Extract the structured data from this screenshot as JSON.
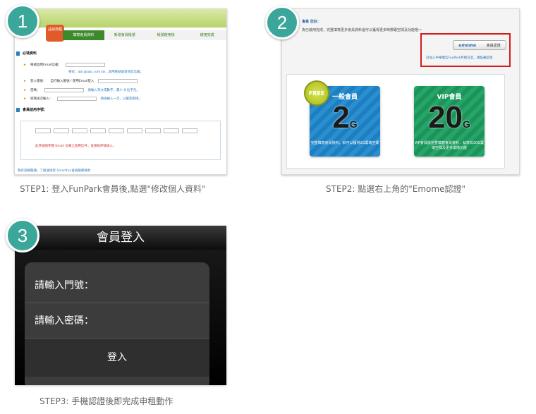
{
  "steps": [
    {
      "number": "1",
      "caption": "STEP1: 登入FunPark會員後,點選\"修改個人資料\"",
      "screenshot": {
        "mascot_text": "註冊流程",
        "nav_items": [
          "填寫會員資料",
          "新增會員帳號",
          "帳號啟用後",
          "啟用完成"
        ],
        "section_required": "必填資料",
        "fields": [
          {
            "label": "帳號啟用Email信箱：",
            "hint": "格式：abc@abc.com.tw，啟用帳號會寄到此信箱。"
          },
          {
            "label": "登入帳號：",
            "hint": "自行輸入帳號 / 使用Email登入"
          },
          {
            "label": "密碼：",
            "hint": "請輸入英文或數字，最少 8 位字元。"
          },
          {
            "label": "密碼再次輸入：",
            "hint": "請再輸入一次，以確認密碼。"
          }
        ],
        "section_pin": "會員啟用序號：",
        "pin_note": "此序號請參閱 Email 信箱之啟用信件，並請依序號填入。",
        "footer": "我有詳細閱讀，了解並接受 Smartfun會員服務條款"
      }
    },
    {
      "number": "2",
      "caption": "STEP2: 點選右上角的\"Emome認證\"",
      "screenshot": {
        "heading": "會員 您好：",
        "subtext": "為已啟用完成，完整填寫更多會員資料還可以獲得更多時數跟空間及功能喔～",
        "emome_logo": "emome",
        "emome_button": "會員認證",
        "emome_note": "已加入中華電信FunPark月租方案，請點選認證",
        "cards": [
          {
            "badge": "FREE",
            "title": "一般會員",
            "big": "2",
            "unit": "G",
            "desc": "完整填寫會員資料，就可以獲得2G雲端空間"
          },
          {
            "badge": "",
            "title": "VIP會員",
            "big": "20",
            "unit": "G",
            "desc": "VIP會員除完整填寫會員資料，就享有20G雲端空間及更多進階功能"
          }
        ]
      }
    },
    {
      "number": "3",
      "caption": "STEP3: 手機認證後即完成申租動作",
      "screenshot": {
        "title": "會員登入",
        "account_prompt": "請輸入門號：",
        "password_prompt": "請輸入密碼：",
        "login_button": "登入"
      }
    }
  ]
}
